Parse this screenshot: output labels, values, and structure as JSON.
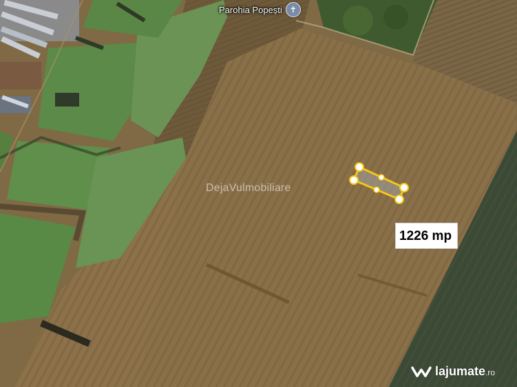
{
  "map": {
    "poi": {
      "label": "Parohia Popești",
      "icon": "cross-icon"
    },
    "watermark": "DejaVulmobiliare",
    "parcel": {
      "area_label": "1226 mp",
      "outline_color": "#f5c518"
    },
    "logo": {
      "text": "lajumate",
      "tld": ".ro"
    }
  }
}
